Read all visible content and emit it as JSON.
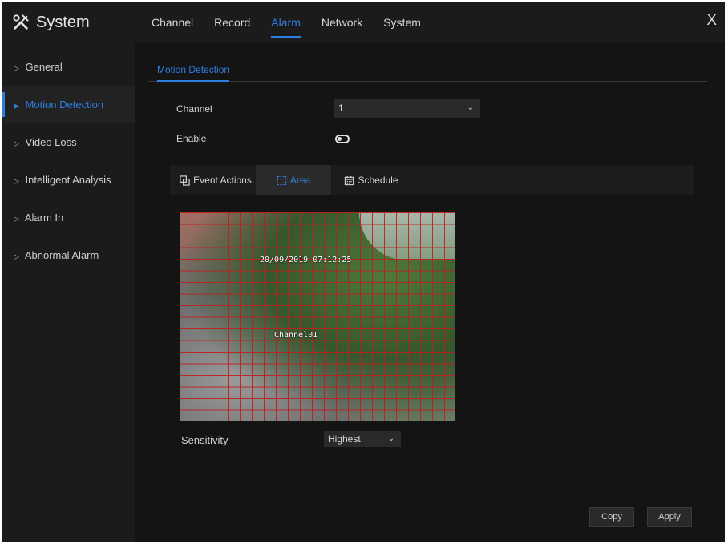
{
  "app": {
    "title": "System",
    "close_glyph": "X"
  },
  "top_tabs": [
    {
      "label": "Channel",
      "active": false
    },
    {
      "label": "Record",
      "active": false
    },
    {
      "label": "Alarm",
      "active": true
    },
    {
      "label": "Network",
      "active": false
    },
    {
      "label": "System",
      "active": false
    }
  ],
  "sidebar": {
    "items": [
      {
        "label": "General",
        "active": false
      },
      {
        "label": "Motion Detection",
        "active": true
      },
      {
        "label": "Video Loss",
        "active": false
      },
      {
        "label": "Intelligent Analysis",
        "active": false
      },
      {
        "label": "Alarm In",
        "active": false
      },
      {
        "label": "Abnormal Alarm",
        "active": false
      }
    ]
  },
  "main": {
    "subtab": "Motion Detection",
    "channel": {
      "label": "Channel",
      "value": "1"
    },
    "enable": {
      "label": "Enable",
      "state": "off"
    },
    "segments": [
      {
        "label": "Event Actions",
        "icon": "event-actions-icon",
        "active": false
      },
      {
        "label": "Area",
        "icon": "area-icon",
        "active": true
      },
      {
        "label": "Schedule",
        "icon": "calendar-icon",
        "active": false
      }
    ],
    "video": {
      "timestamp": "20/09/2019 07:12:25",
      "channel_osd": "Channel01"
    },
    "sensitivity": {
      "label": "Sensitivity",
      "value": "Highest"
    },
    "buttons": {
      "copy": "Copy",
      "apply": "Apply"
    }
  },
  "colors": {
    "accent": "#2f7fe0",
    "background": "#141414",
    "panel": "#1b1b1b",
    "grid_line": "#be1e1e"
  }
}
